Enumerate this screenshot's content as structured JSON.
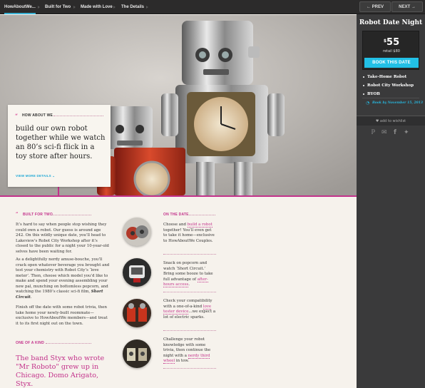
{
  "nav": {
    "tabs": [
      {
        "label": "HowAboutWe..."
      },
      {
        "label": "Built for Two"
      },
      {
        "label": "Made with Love"
      },
      {
        "label": "The Details"
      }
    ],
    "prev": "PREV",
    "next": "NEXT"
  },
  "sidebar": {
    "title": "Robot Date Night",
    "price": "55",
    "currency": "$",
    "retail": "retail $80",
    "book_button": "BOOK THIS DATE",
    "includes": [
      "Take-Home Robot",
      "Robot City Workshop",
      "BYOB"
    ],
    "book_by": "Book by November 15, 2013",
    "wishlist": "add to wishlist",
    "social": [
      "pinterest-icon",
      "email-icon",
      "facebook-icon",
      "twitter-icon"
    ]
  },
  "how": {
    "label": "HOW ABOUT WE",
    "text": "build our own robot together while we watch an 80’s sci-fi flick in a toy store after hours.",
    "more": "VIEW MORE DETAILS"
  },
  "built": {
    "label": "BUILT FOR TWO",
    "p1": "It’s hard to say when people stop wishing they could own a robot. Our guess is around age 242. On this wildly unique date, you’ll head to Lakeview’s Robot City Workshop after it’s closed to the public for a night your 10-year-old selves have been waiting for.",
    "p2a": "As a delightfully nerdy amuse-bouche, you’ll crack open whatever beverage you brought and test your chemistry with Robot City’s ‘love meter’. Then, choose which model you’d like to make and spend your evening assembling your new pal, munching on bottomless popcorn, and watching the 1980’s classic sci-fi film, ",
    "p2b": "Short Circuit",
    "p2c": ".",
    "p3": "Finish off the date with some robot trivia, then take home your newly-built roommate—exclusive to HowAboutWe members—and treat it to its first night out on the town."
  },
  "kind": {
    "label": "ONE OF A KIND",
    "text": "The band Styx who wrote \"Mr Roboto\" grew up in Chicago. Domo Arigato, Styx."
  },
  "date": {
    "label": "ON THE DATE",
    "items": [
      {
        "pre": "Choose and ",
        "link": "build a robot",
        "post": " together! You’ll even get to take it home—exclusive to HowAboutWe Couples."
      },
      {
        "pre": "Snack on popcorn and watch ‘Short Circuit.’ Bring some booze to take full advantage of ",
        "link": "after-hours access",
        "post": "."
      },
      {
        "pre": "Check your compatibility with a one-of-a-kind ",
        "link": "love tester device",
        "post": "...we expect a lot of electric sparks."
      },
      {
        "pre": "Challenge your robot knowledge with some trivia, then continue the night with a ",
        "link": "nerdy third wheel",
        "post": " in tow."
      }
    ]
  },
  "colors": {
    "accent": "#c3328b",
    "button": "#22c0e6",
    "sidebar": "#3a3a3b",
    "nav": "#2c2b2b"
  }
}
